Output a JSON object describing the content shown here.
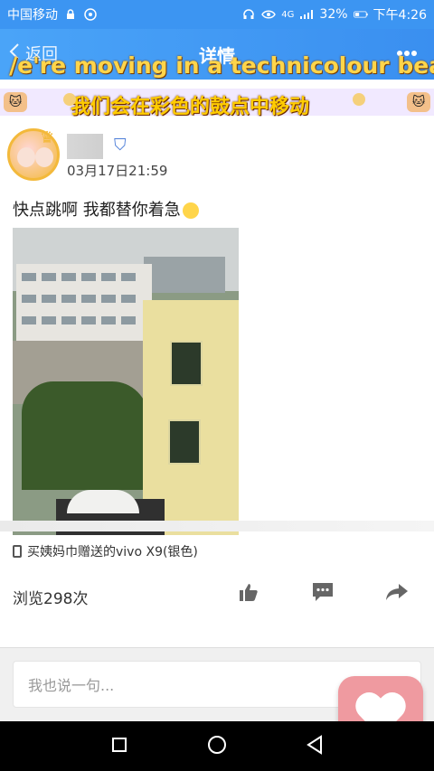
{
  "status_bar": {
    "carrier": "中国移动",
    "battery": "32%",
    "time": "下午4:26",
    "network": "4G"
  },
  "header": {
    "back_label": "返回",
    "title": "详情",
    "more_icon": "more-dots"
  },
  "overlay": {
    "english": "/e're moving in a technicolour beat",
    "chinese": "我们会在彩色的鼓点中移动"
  },
  "post": {
    "time": "03月17日21:59",
    "text": "快点跳啊 我都替你着急",
    "device": "买姨妈巾赠送的vivo X9(银色)",
    "views": "浏览298次"
  },
  "actions": {
    "like_icon": "thumbs-up",
    "comment_icon": "comment",
    "share_icon": "share-arrow"
  },
  "input": {
    "placeholder": "我也说一句..."
  },
  "navbar": {
    "icons": [
      "square",
      "circle",
      "triangle"
    ]
  }
}
